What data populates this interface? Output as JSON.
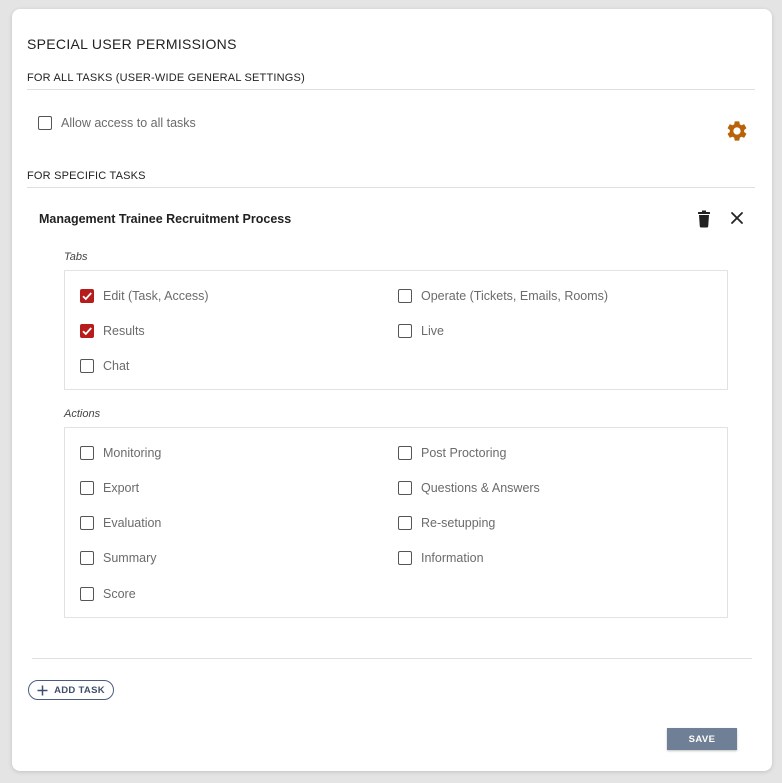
{
  "title": "SPECIAL USER PERMISSIONS",
  "all_tasks": {
    "header": "FOR ALL TASKS (USER-WIDE GENERAL SETTINGS)",
    "allow_all_label": "Allow access to all tasks",
    "allow_all_checked": false,
    "settings_icon": "gear-icon"
  },
  "specific_tasks": {
    "header": "FOR SPECIFIC TASKS",
    "task": {
      "name": "Management Trainee Recruitment Process",
      "delete_icon": "trash-icon",
      "close_icon": "close-icon",
      "tabs": {
        "label": "Tabs",
        "items": [
          {
            "label": "Edit (Task, Access)",
            "checked": true
          },
          {
            "label": "Operate (Tickets, Emails, Rooms)",
            "checked": false
          },
          {
            "label": "Results",
            "checked": true
          },
          {
            "label": "Live",
            "checked": false
          },
          {
            "label": "Chat",
            "checked": false
          }
        ]
      },
      "actions": {
        "label": "Actions",
        "items": [
          {
            "label": "Monitoring",
            "checked": false
          },
          {
            "label": "Post Proctoring",
            "checked": false
          },
          {
            "label": "Export",
            "checked": false
          },
          {
            "label": "Questions & Answers",
            "checked": false
          },
          {
            "label": "Evaluation",
            "checked": false
          },
          {
            "label": "Re-setupping",
            "checked": false
          },
          {
            "label": "Summary",
            "checked": false
          },
          {
            "label": "Information",
            "checked": false
          },
          {
            "label": "Score",
            "checked": false
          }
        ]
      }
    }
  },
  "add_task_label": "ADD TASK",
  "save_label": "SAVE",
  "colors": {
    "accent_check": "#b71c1c",
    "gear": "#b8620a",
    "save_bg": "#6e7f96",
    "add_border": "#4a5d7e"
  }
}
